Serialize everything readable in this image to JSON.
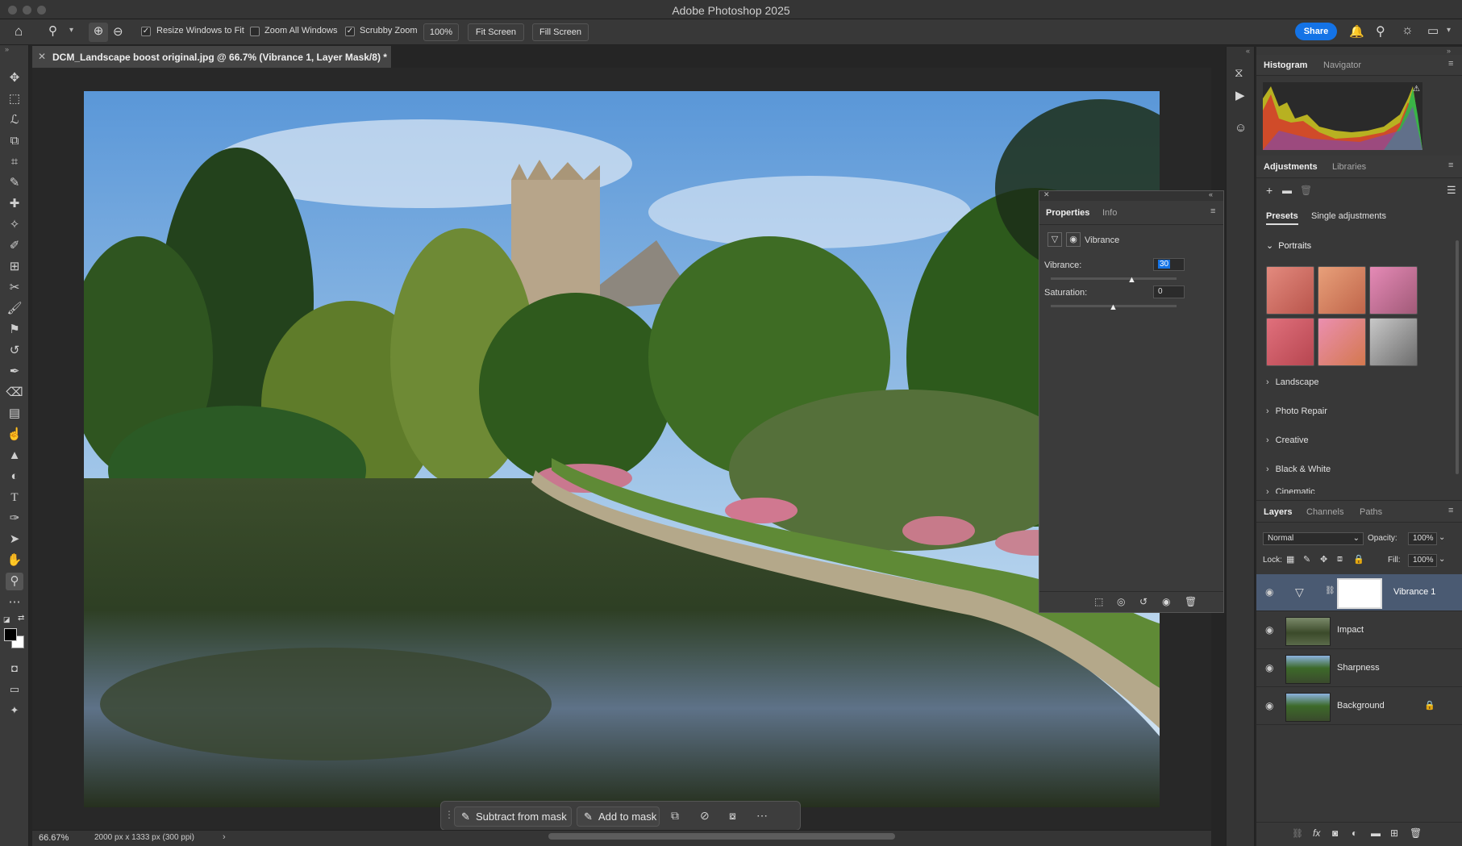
{
  "app": {
    "title": "Adobe Photoshop 2025"
  },
  "options_bar": {
    "resize_windows": "Resize Windows to Fit",
    "zoom_all": "Zoom All Windows",
    "scrubby_zoom": "Scrubby Zoom",
    "zoom_value": "100%",
    "fit_screen": "Fit Screen",
    "fill_screen": "Fill Screen",
    "share": "Share"
  },
  "document": {
    "tab_title": "DCM_Landscape boost original.jpg @ 66.7% (Vibrance 1, Layer Mask/8) *",
    "zoom": "66.67%",
    "dimensions": "2000 px x 1333 px (300 ppi)"
  },
  "task_bar": {
    "subtract": "Subtract from mask",
    "add": "Add to mask"
  },
  "properties": {
    "tab_properties": "Properties",
    "tab_info": "Info",
    "layer_type": "Vibrance",
    "vibrance_label": "Vibrance:",
    "vibrance_value": "30",
    "saturation_label": "Saturation:",
    "saturation_value": "0"
  },
  "histogram": {
    "tab_histogram": "Histogram",
    "tab_navigator": "Navigator"
  },
  "adjustments": {
    "tab_adjustments": "Adjustments",
    "tab_libraries": "Libraries",
    "tab_presets": "Presets",
    "tab_single": "Single adjustments",
    "portraits": "Portraits",
    "landscape": "Landscape",
    "photo_repair": "Photo Repair",
    "creative": "Creative",
    "black_white": "Black & White",
    "cinematic": "Cinematic"
  },
  "layers": {
    "tab_layers": "Layers",
    "tab_channels": "Channels",
    "tab_paths": "Paths",
    "blend_mode": "Normal",
    "opacity_label": "Opacity:",
    "opacity_value": "100%",
    "lock_label": "Lock:",
    "fill_label": "Fill:",
    "fill_value": "100%",
    "items": [
      {
        "name": "Vibrance 1"
      },
      {
        "name": "Impact"
      },
      {
        "name": "Sharpness"
      },
      {
        "name": "Background"
      }
    ]
  },
  "colors": {
    "accent": "#1473e6",
    "selected_layer": "#4a5a72"
  }
}
